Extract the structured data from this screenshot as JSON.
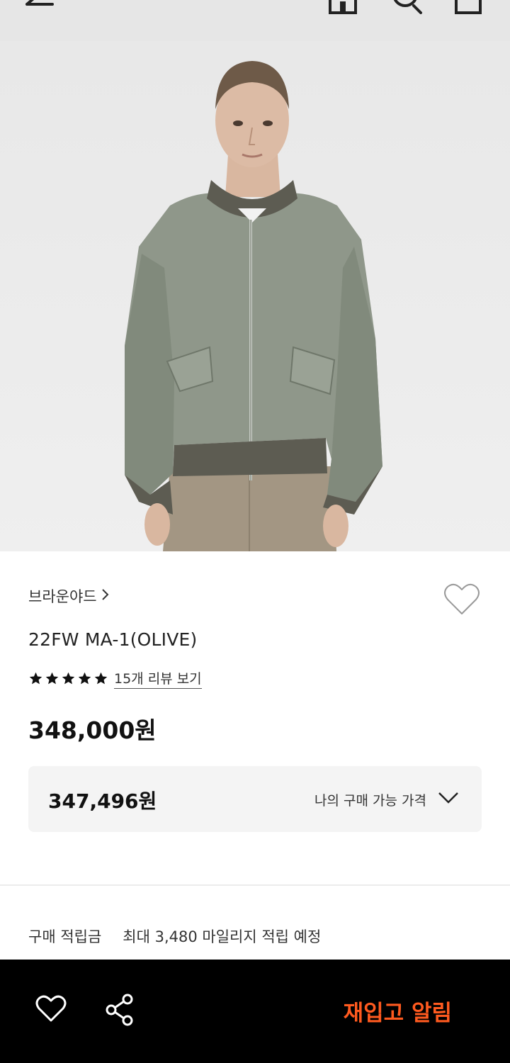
{
  "header": {
    "icons": [
      "back-arrow-icon",
      "home-icon",
      "search-icon",
      "cart-icon"
    ]
  },
  "product": {
    "brand": "브라운야드",
    "name": "22FW MA-1(OLIVE)",
    "rating_stars": 5,
    "review_link": "15개 리뷰 보기",
    "price": "348,000원"
  },
  "my_price": {
    "value": "347,496원",
    "label": "나의 구매 가능 가격"
  },
  "points": {
    "label": "구매 적립금",
    "value": "최대 3,480 마일리지 적립 예정"
  },
  "bottom_bar": {
    "restock_label": "재입고 알림"
  },
  "colors": {
    "accent": "#ff5a1f",
    "bottom_bar_bg": "#000000",
    "jacket": "#8f978a"
  }
}
